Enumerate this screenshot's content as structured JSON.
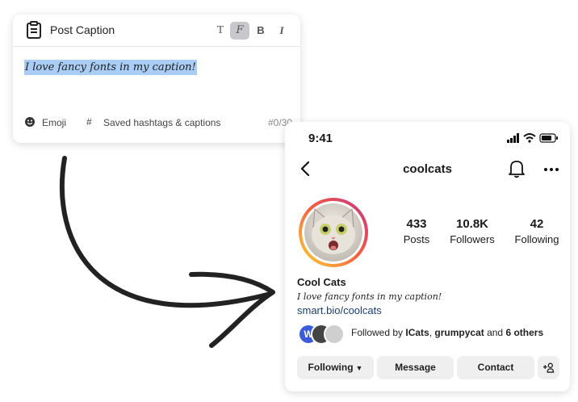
{
  "editor": {
    "title": "Post Caption",
    "format_buttons": [
      "T",
      "F",
      "B",
      "I"
    ],
    "caption_text": "I love fancy fonts in my caption!",
    "emoji_label": "Emoji",
    "hashtag_label": "Saved hashtags & captions",
    "hashtag_symbol": "#",
    "counter": "#0/30"
  },
  "profile": {
    "time": "9:41",
    "username": "coolcats",
    "stats": [
      {
        "value": "433",
        "label": "Posts"
      },
      {
        "value": "10.8K",
        "label": "Followers"
      },
      {
        "value": "42",
        "label": "Following"
      }
    ],
    "display_name": "Cool Cats",
    "bio": "I love fancy fonts in my caption!",
    "link": "smart.bio/coolcats",
    "followed_by_prefix": "Followed by ",
    "followed_by_user1": "ICats",
    "followed_by_sep": ", ",
    "followed_by_user2": "grumpycat",
    "followed_by_mid": " and ",
    "followed_by_others": "6 others",
    "mini_avatar_letter": "W",
    "buttons": {
      "following": "Following",
      "message": "Message",
      "contact": "Contact"
    }
  },
  "colors": {
    "highlight": "#a9cdf5",
    "link": "#1b3f73",
    "button_bg": "#efefef",
    "story_ring": [
      "#fdd835",
      "#f56040",
      "#c13584"
    ]
  }
}
